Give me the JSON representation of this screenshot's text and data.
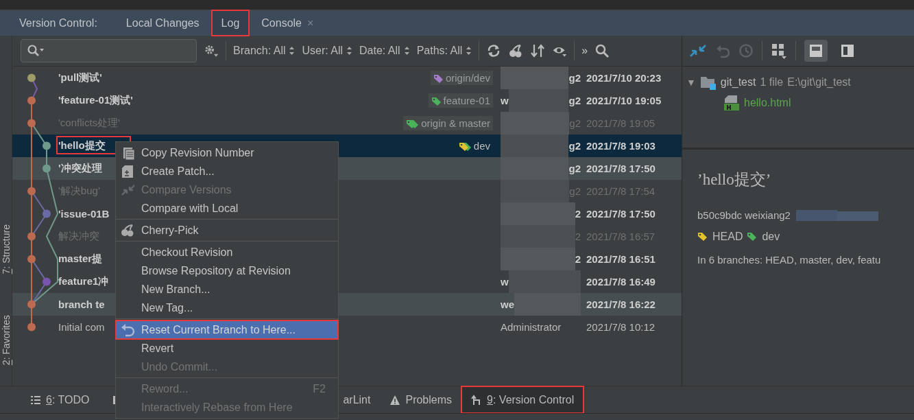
{
  "tool_window": {
    "title": "Version Control:",
    "tabs": [
      {
        "label": "Local Changes",
        "selected": false,
        "closable": false,
        "annotated": false
      },
      {
        "label": "Log",
        "selected": true,
        "closable": false,
        "annotated": true
      },
      {
        "label": "Console",
        "selected": false,
        "closable": true,
        "close_glyph": "×",
        "annotated": false
      }
    ]
  },
  "side_stripe": [
    {
      "mnemonic": "7",
      "label": ": Structure"
    },
    {
      "mnemonic": "2",
      "label": ": Favorites"
    }
  ],
  "filters": [
    {
      "label": "Branch: All"
    },
    {
      "label": "User: All"
    },
    {
      "label": "Date: All"
    },
    {
      "label": "Paths: All"
    }
  ],
  "more_glyph": "»",
  "commits": [
    {
      "subject": "'pull测试'",
      "kind": "bold",
      "selected": false,
      "highlighted": false,
      "annotated": false,
      "color": "#9d9c6a",
      "tag": {
        "label": "origin/dev",
        "kind": "single",
        "color": "#a47cc9"
      },
      "redacted": true,
      "author_tail": "g2",
      "date": "2021/7/10 20:23"
    },
    {
      "subject": "'feature-01测试'",
      "kind": "bold",
      "selected": false,
      "highlighted": false,
      "annotated": false,
      "color": "#bd6b50",
      "tag": {
        "label": "feature-01",
        "kind": "single",
        "color": "#4bb35a"
      },
      "redacted": true,
      "author_lead": "w",
      "author_tail": "g2",
      "date": "2021/7/10 19:05"
    },
    {
      "subject": "'conflicts处理'",
      "kind": "dim",
      "selected": false,
      "highlighted": false,
      "annotated": false,
      "color": "#bd6b50",
      "tag": {
        "label": "origin & master",
        "kind": "double",
        "color": "#4bb35a"
      },
      "redacted": true,
      "author_tail": "g2",
      "date": "2021/7/8 19:05"
    },
    {
      "subject": "'hello提交",
      "kind": "bold",
      "selected": true,
      "highlighted": false,
      "annotated": true,
      "color": "#6f9a8b",
      "tag": {
        "label": "dev",
        "kind": "double",
        "color": "#e2c32f"
      },
      "redacted": true,
      "author_tail": "g2",
      "date": "2021/7/8 19:03"
    },
    {
      "subject": "'冲突处理",
      "kind": "bold",
      "selected": false,
      "highlighted": true,
      "annotated": false,
      "color": "#6f9a8b",
      "redacted": true,
      "author_tail": "g2",
      "date": "2021/7/8 17:50"
    },
    {
      "subject": "'解决bug'",
      "kind": "dim",
      "selected": false,
      "highlighted": false,
      "annotated": false,
      "color": "#bd6b50",
      "redacted": true,
      "author_tail": "g2",
      "date": "2021/7/8 17:54"
    },
    {
      "subject": "'issue-01B",
      "kind": "bold",
      "selected": false,
      "highlighted": false,
      "annotated": false,
      "color": "#6a6aa6",
      "redacted": true,
      "author_tail": "2",
      "date": "2021/7/8 17:50"
    },
    {
      "subject": "解决冲突",
      "kind": "dim",
      "selected": false,
      "highlighted": false,
      "annotated": false,
      "color": "#bd6b50",
      "redacted": true,
      "author_tail": "2",
      "date": "2021/7/8 16:57"
    },
    {
      "subject": "master提",
      "kind": "bold",
      "selected": false,
      "highlighted": false,
      "annotated": false,
      "color": "#bd6b50",
      "redacted": true,
      "author_tail": "2",
      "date": "2021/7/8 16:51"
    },
    {
      "subject": "feature1冲",
      "kind": "bold",
      "selected": false,
      "highlighted": false,
      "annotated": false,
      "color": "#7a55b0",
      "redacted": true,
      "author_lead": "w",
      "date": "2021/7/8 16:49"
    },
    {
      "subject": "branch te",
      "kind": "bold",
      "selected": false,
      "highlighted": true,
      "annotated": false,
      "color": "#bd6b50",
      "redacted": true,
      "author_lead": "we",
      "date": "2021/7/8 16:22"
    },
    {
      "subject": "Initial com",
      "kind": "plain",
      "selected": false,
      "highlighted": false,
      "annotated": false,
      "color": "#bd6b50",
      "redacted": false,
      "author_lead": "Administrator",
      "date": "2021/7/8 10:12"
    }
  ],
  "layout_toggles": [
    {
      "selected": true
    },
    {
      "selected": false
    }
  ],
  "changes": {
    "name": "git_test",
    "count": "1 file",
    "path": "E:\\git\\git_test",
    "expanded": true,
    "caret_glyph": "▼",
    "children": [
      {
        "name": "hello.html"
      }
    ]
  },
  "details": {
    "title": "’hello提交’",
    "meta": "b50c9bdc weixiang2",
    "refs": [
      {
        "label": "HEAD",
        "color": "#e2c32f"
      },
      {
        "label": "dev",
        "color": "#4bb35a"
      }
    ],
    "branches": "In 6 branches: HEAD, master, dev, featu"
  },
  "context_menu": [
    {
      "kind": "copy",
      "label": "Copy Revision Number",
      "disabled": false,
      "selected": false,
      "annotated": false
    },
    {
      "kind": "patch",
      "label": "Create Patch...",
      "disabled": false,
      "selected": false,
      "annotated": false
    },
    {
      "kind": "compare",
      "label": "Compare Versions",
      "disabled": true,
      "selected": false,
      "annotated": false
    },
    {
      "kind": "command",
      "label": "Compare with Local",
      "disabled": false,
      "selected": false,
      "annotated": false
    },
    {
      "kind": "separator"
    },
    {
      "kind": "cherry",
      "label": "Cherry-Pick",
      "disabled": false,
      "selected": false,
      "annotated": false
    },
    {
      "kind": "separator"
    },
    {
      "kind": "command",
      "label": "Checkout Revision",
      "disabled": false,
      "selected": false,
      "annotated": false
    },
    {
      "kind": "command",
      "label": "Browse Repository at Revision",
      "disabled": false,
      "selected": false,
      "annotated": false
    },
    {
      "kind": "command",
      "label": "New Branch...",
      "disabled": false,
      "selected": false,
      "annotated": false
    },
    {
      "kind": "command",
      "label": "New Tag...",
      "disabled": false,
      "selected": false,
      "annotated": false
    },
    {
      "kind": "separator"
    },
    {
      "kind": "reset",
      "label": "Reset Current Branch to Here...",
      "disabled": false,
      "selected": true,
      "annotated": true
    },
    {
      "kind": "command",
      "label": "Revert",
      "disabled": false,
      "selected": false,
      "annotated": false
    },
    {
      "kind": "command",
      "label": "Undo Commit...",
      "disabled": true,
      "selected": false,
      "annotated": false
    },
    {
      "kind": "separator"
    },
    {
      "kind": "command",
      "label": "Reword...",
      "shortcut": "F2",
      "disabled": true,
      "selected": false,
      "annotated": false
    },
    {
      "kind": "command",
      "label": "Interactively Rebase from Here",
      "disabled": true,
      "selected": false,
      "annotated": false
    }
  ],
  "bottom_tabs": [
    {
      "kind": "todo",
      "mnemonic": "6",
      "label": ": TODO",
      "selected": false,
      "annotated": false
    },
    {
      "kind": "terminal",
      "selected": false,
      "annotated": false
    },
    {
      "kind": "plain",
      "label": "arLint",
      "selected": false,
      "annotated": false
    },
    {
      "kind": "problems",
      "label": "Problems",
      "selected": false,
      "annotated": false
    },
    {
      "kind": "vcs",
      "mnemonic": "9",
      "label": ": Version Control",
      "selected": true,
      "annotated": true
    }
  ]
}
